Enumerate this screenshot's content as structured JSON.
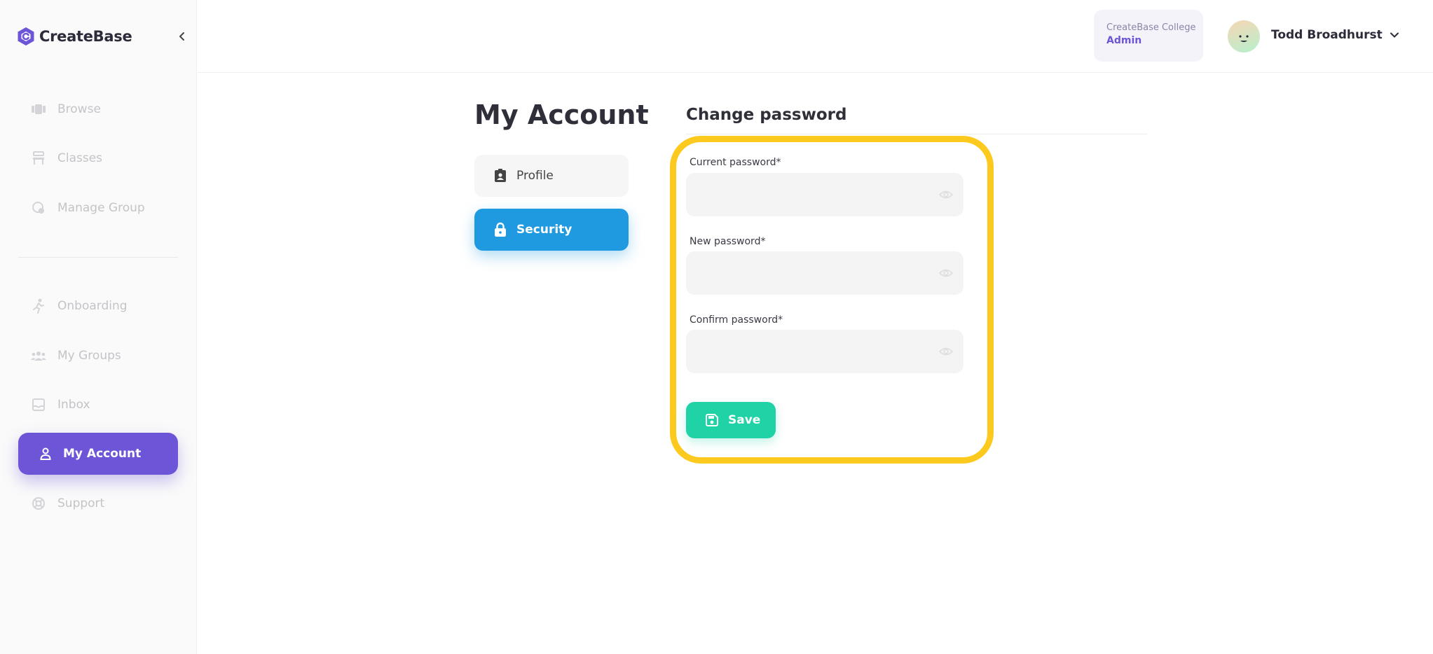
{
  "app": {
    "name": "CreateBase"
  },
  "sidebar": {
    "items": [
      {
        "label": "Browse",
        "icon": "browse-icon"
      },
      {
        "label": "Classes",
        "icon": "classes-icon"
      },
      {
        "label": "Manage Group",
        "icon": "manage-group-icon"
      },
      {
        "label": "Onboarding",
        "icon": "onboarding-icon"
      },
      {
        "label": "My Groups",
        "icon": "groups-icon"
      },
      {
        "label": "Inbox",
        "icon": "inbox-icon"
      },
      {
        "label": "My Account",
        "icon": "person-icon",
        "active": true
      },
      {
        "label": "Support",
        "icon": "support-icon"
      }
    ]
  },
  "header": {
    "org_name": "CreateBase College",
    "org_role": "Admin",
    "user_name": "Todd Broadhurst"
  },
  "page": {
    "title": "My Account",
    "tabs": [
      {
        "label": "Profile",
        "icon": "profile-badge-icon"
      },
      {
        "label": "Security",
        "icon": "lock-icon",
        "active": true
      }
    ]
  },
  "form": {
    "title": "Change password",
    "current_label": "Current password*",
    "current_value": "",
    "new_label": "New password*",
    "new_value": "",
    "confirm_label": "Confirm password*",
    "confirm_value": "",
    "save_label": "Save"
  },
  "colors": {
    "brand_purple": "#6e55d8",
    "security_blue": "#1f9ae0",
    "save_green": "#20d3a7",
    "highlight_yellow": "#fcca1e"
  }
}
